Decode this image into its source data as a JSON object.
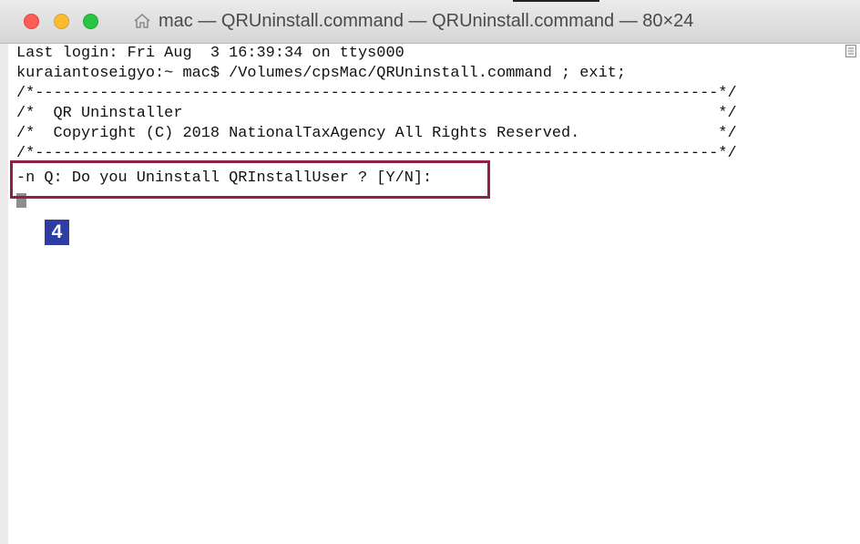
{
  "window": {
    "title": "mac — QRUninstall.command — QRUninstall.command — 80×24"
  },
  "terminal": {
    "lines": [
      "Last login: Fri Aug  3 16:39:34 on ttys000",
      "kuraiantoseigyo:~ mac$ /Volumes/cpsMac/QRUninstall.command ; exit;",
      "/*--------------------------------------------------------------------------*/",
      "/*  QR Uninstaller                                                          */",
      "/*  Copyright (C) 2018 NationalTaxAgency All Rights Reserved.               */",
      "/*--------------------------------------------------------------------------*/",
      "-n Q: Do you Uninstall QRInstallUser ? [Y/N]:"
    ]
  },
  "annotation": {
    "step_number": "4",
    "highlight_color": "#8f2244",
    "badge_color": "#2d3da2"
  },
  "icons": {
    "home": "home-icon",
    "scroll": "scroll-icon"
  },
  "colors": {
    "close": "#fd5c55",
    "minimize": "#fdbb2e",
    "maximize": "#2bc641"
  }
}
